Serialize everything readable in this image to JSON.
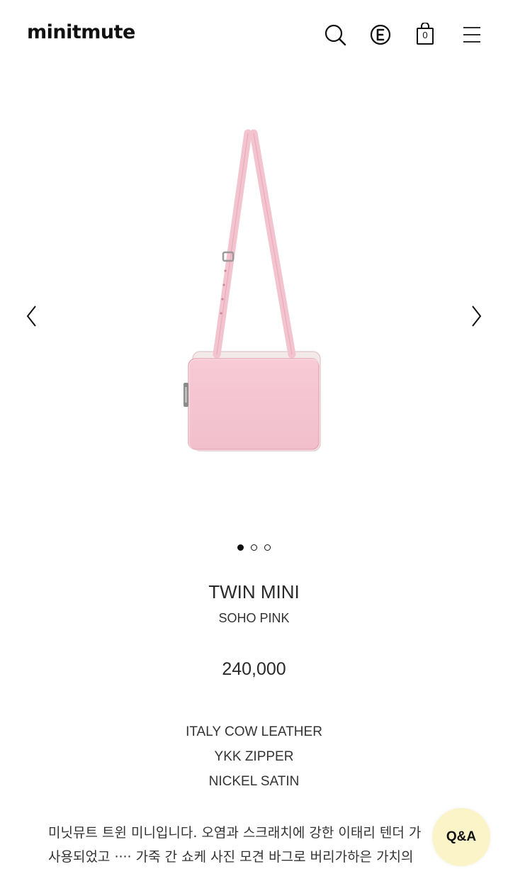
{
  "header": {
    "logo": "minitmute",
    "cart_count": "0"
  },
  "gallery": {
    "slide_count": 3,
    "active_slide": 1
  },
  "product": {
    "name": "TWIN MINI",
    "color": "SOHO PINK",
    "price": "240,000",
    "specs": [
      "ITALY COW LEATHER",
      "YKK ZIPPER",
      "NICKEL SATIN"
    ],
    "description": [
      "미닛뮤트 트윈 미니입니다. 오염과 스크래치에 강한 이태리 텐더 가",
      "사용되었고 ···· 가죽 간 쇼케 사진 모견 바그로 버리가하은 가치의"
    ]
  },
  "qa_button": {
    "label": "Q&A",
    "bg": "#fbf4c8"
  },
  "colors": {
    "bag_pink": "#f3c3d0",
    "text": "#222222"
  },
  "icons": [
    "search-icon",
    "e-coin-icon",
    "shopping-bag-icon",
    "menu-icon",
    "chevron-left-icon",
    "chevron-right-icon"
  ]
}
